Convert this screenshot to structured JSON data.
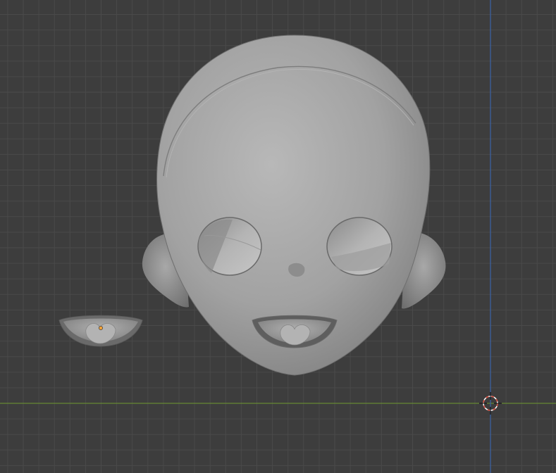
{
  "viewport": {
    "background_color": "#3d3d3d",
    "grid_color": "#4a4a4a",
    "x_axis_color": "#6f9a2e",
    "y_axis_color": "#3b63a8",
    "cursor_color": "#d94a3a",
    "origin_color": "#f2a23a",
    "mesh_color": "#9e9e9e"
  },
  "objects": [
    {
      "name": "head-mesh"
    },
    {
      "name": "mouth-piece-mesh"
    }
  ],
  "icons": [
    "3d-cursor-icon",
    "object-origin-icon"
  ]
}
